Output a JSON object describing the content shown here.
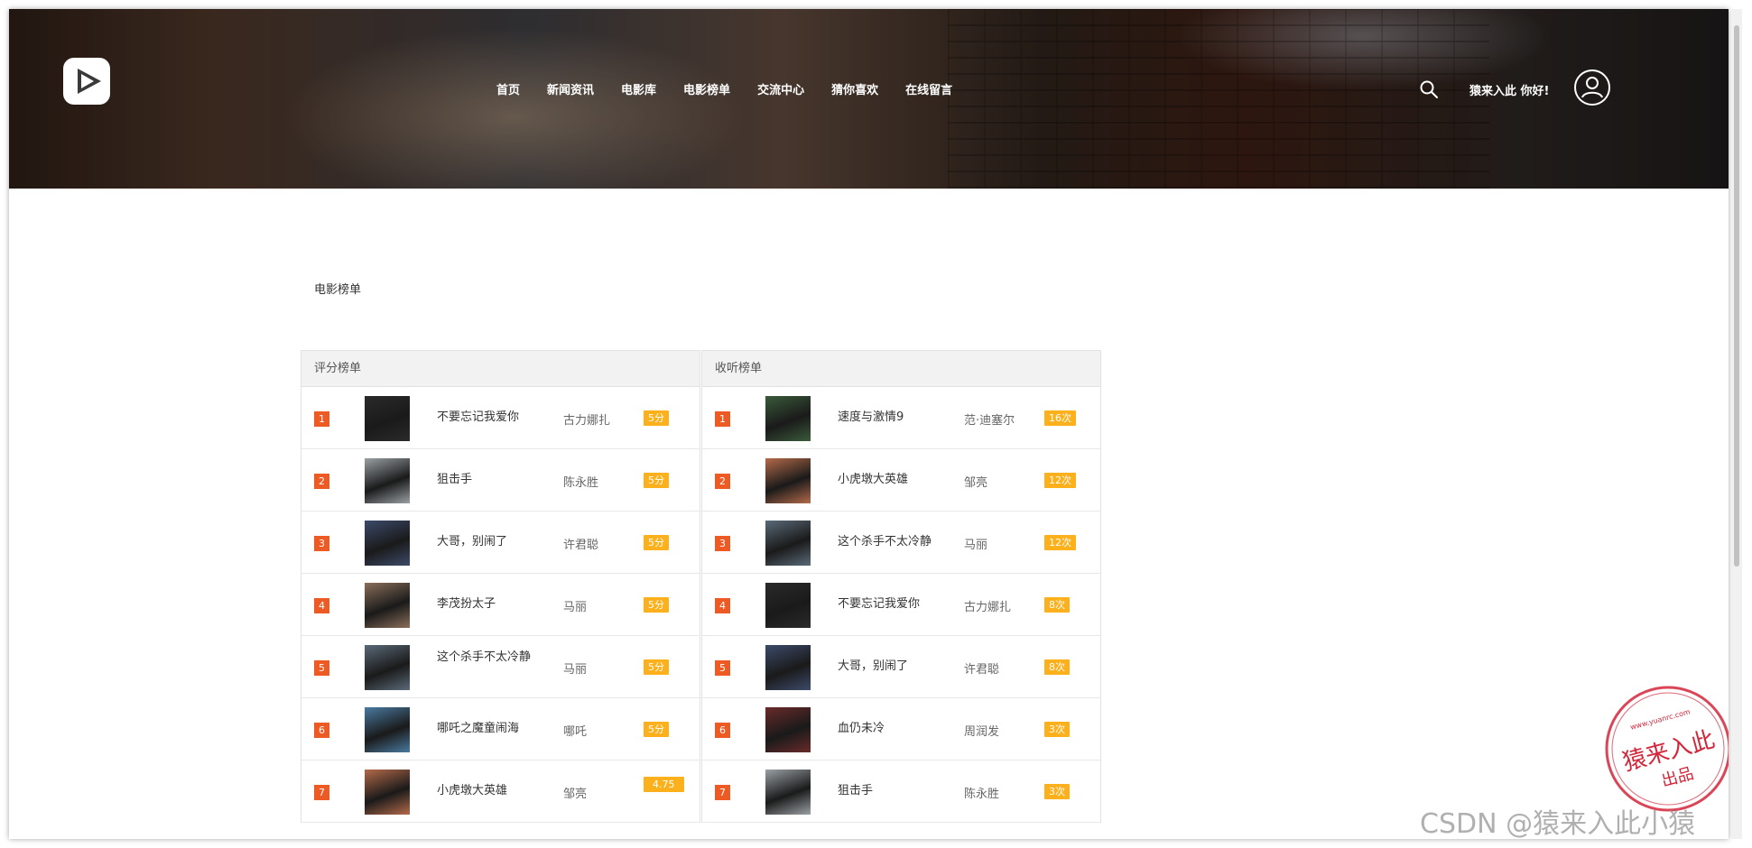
{
  "header": {
    "nav": [
      "首页",
      "新闻资讯",
      "电影库",
      "电影榜单",
      "交流中心",
      "猜你喜欢",
      "在线留言"
    ],
    "greeting": "猿来入此 你好!"
  },
  "page": {
    "section_title": "电影榜单"
  },
  "score_table": {
    "title": "评分榜单",
    "rows": [
      {
        "rank": "1",
        "name": "不要忘记我爱你",
        "person": "古力娜扎",
        "tag": "5分",
        "color": "#2a2a2a"
      },
      {
        "rank": "2",
        "name": "狙击手",
        "person": "陈永胜",
        "tag": "5分",
        "color": "#9aa0a4"
      },
      {
        "rank": "3",
        "name": "大哥，别闹了",
        "person": "许君聪",
        "tag": "5分",
        "color": "#3c4a6a"
      },
      {
        "rank": "4",
        "name": "李茂扮太子",
        "person": "马丽",
        "tag": "5分",
        "color": "#8a6e5a"
      },
      {
        "rank": "5",
        "name": "这个杀手不太冷静",
        "person": "马丽",
        "tag": "5分",
        "color": "#5a6a78"
      },
      {
        "rank": "6",
        "name": "哪吒之魔童闹海",
        "person": "哪吒",
        "tag": "5分",
        "color": "#4a7aa0"
      },
      {
        "rank": "7",
        "name": "小虎墩大英雄",
        "person": "邹亮",
        "tag": "4.75",
        "color": "#b46a4a"
      }
    ]
  },
  "listen_table": {
    "title": "收听榜单",
    "rows": [
      {
        "rank": "1",
        "name": "速度与激情9",
        "person": "范·迪塞尔",
        "tag": "16次",
        "color": "#3a5a3a"
      },
      {
        "rank": "2",
        "name": "小虎墩大英雄",
        "person": "邹亮",
        "tag": "12次",
        "color": "#b46a4a"
      },
      {
        "rank": "3",
        "name": "这个杀手不太冷静",
        "person": "马丽",
        "tag": "12次",
        "color": "#5a6a78"
      },
      {
        "rank": "4",
        "name": "不要忘记我爱你",
        "person": "古力娜扎",
        "tag": "8次",
        "color": "#2a2a2a"
      },
      {
        "rank": "5",
        "name": "大哥，别闹了",
        "person": "许君聪",
        "tag": "8次",
        "color": "#3c4a6a"
      },
      {
        "rank": "6",
        "name": "血仍未冷",
        "person": "周润发",
        "tag": "3次",
        "color": "#6a2a2a"
      },
      {
        "rank": "7",
        "name": "狙击手",
        "person": "陈永胜",
        "tag": "3次",
        "color": "#9aa0a4"
      }
    ]
  },
  "stamp": {
    "text_main": "猿来入此",
    "text_sub": "出品",
    "text_url": "www.yuanrc.com"
  },
  "watermark": "CSDN @猿来入此小猿",
  "colors": {
    "rank_badge": "#ee5a24",
    "tag": "#fbb01c"
  }
}
